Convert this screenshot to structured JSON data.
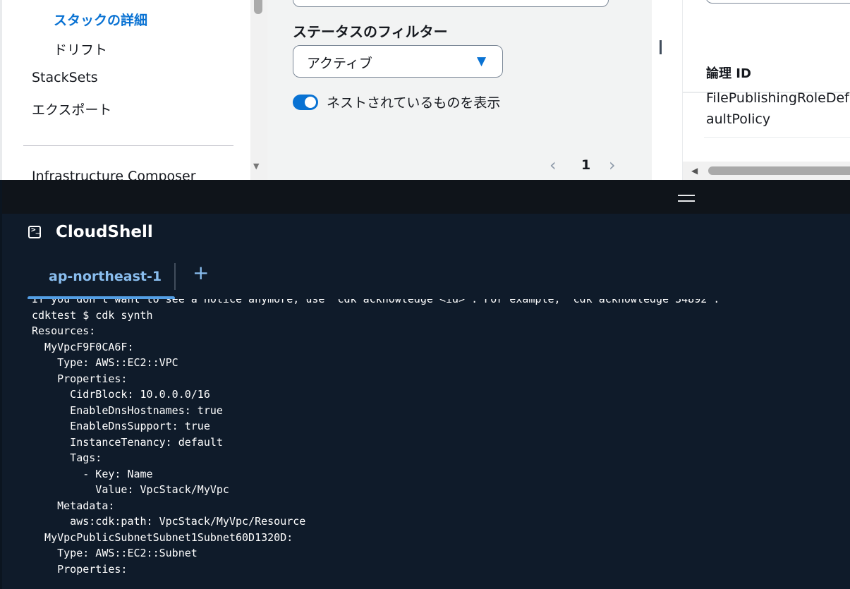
{
  "nav": {
    "items": [
      {
        "label": "スタックの詳細",
        "active": true
      },
      {
        "label": "ドリフト",
        "active": false
      },
      {
        "label": "StackSets",
        "active": false
      },
      {
        "label": "エクスポート",
        "active": false
      },
      {
        "label": "Infrastructure Composer",
        "active": false
      }
    ]
  },
  "filter": {
    "status_label": "ステータスのフィルター",
    "status_value": "アクティブ",
    "nested_toggle_on": true,
    "nested_label": "ネストされているものを表示"
  },
  "pagination": {
    "current_page": "1"
  },
  "resources": {
    "column_header": "論理 ID",
    "cell_text": "FilePublishingRoleDefaultPolicy"
  },
  "cloudshell": {
    "title": "CloudShell",
    "active_tab": "ap-northeast-1",
    "add_tab_symbol": "+",
    "lines": [
      "If you don’t want to see a notice anymore, use \"cdk acknowledge <id>\". For example, \"cdk acknowledge 34892\".",
      "cdktest $ cdk synth",
      "Resources:",
      "  MyVpcF9F0CA6F:",
      "    Type: AWS::EC2::VPC",
      "    Properties:",
      "      CidrBlock: 10.0.0.0/16",
      "      EnableDnsHostnames: true",
      "      EnableDnsSupport: true",
      "      InstanceTenancy: default",
      "      Tags:",
      "        - Key: Name",
      "          Value: VpcStack/MyVpc",
      "    Metadata:",
      "      aws:cdk:path: VpcStack/MyVpc/Resource",
      "  MyVpcPublicSubnetSubnet1Subnet60D1320D:",
      "    Type: AWS::EC2::Subnet",
      "    Properties:"
    ]
  },
  "colors": {
    "accent": "#0972d3",
    "shell_background": "#0f1b2a",
    "tab_accent": "#539fe5"
  }
}
